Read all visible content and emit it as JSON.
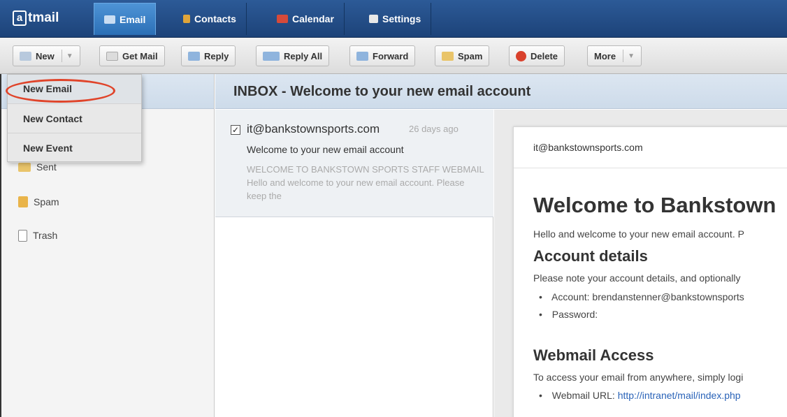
{
  "app": {
    "logo_text": "tmail",
    "logo_prefix": "a"
  },
  "nav": {
    "tabs": [
      {
        "label": "Email",
        "active": true
      },
      {
        "label": "Contacts",
        "active": false
      },
      {
        "label": "Calendar",
        "active": false
      },
      {
        "label": "Settings",
        "active": false
      }
    ]
  },
  "toolbar": {
    "new_label": "New",
    "get_mail_label": "Get Mail",
    "reply_label": "Reply",
    "reply_all_label": "Reply All",
    "forward_label": "Forward",
    "spam_label": "Spam",
    "delete_label": "Delete",
    "more_label": "More"
  },
  "new_menu": {
    "items": [
      "New Email",
      "New Contact",
      "New Event"
    ],
    "highlighted": "New Email",
    "highlight_color": "#e0442a"
  },
  "folders": [
    {
      "label": "Sent",
      "icon": "sent-icon"
    },
    {
      "label": "Spam",
      "icon": "spam-folder-icon"
    },
    {
      "label": "Trash",
      "icon": "trash-icon"
    }
  ],
  "inbox": {
    "title": "INBOX - Welcome to your new email account"
  },
  "message": {
    "from": "it@bankstownsports.com",
    "age": "26 days ago",
    "subject": "Welcome to your new email account",
    "preview": "WELCOME TO BANKSTOWN SPORTS STAFF WEBMAIL Hello and welcome to your new email account. Please keep the",
    "checked": true
  },
  "reading": {
    "from": "it@bankstownsports.com",
    "heading": "Welcome to Bankstown",
    "intro": "Hello and welcome to your new email account. P",
    "account_heading": "Account details",
    "account_note": "Please note your account details, and optionally",
    "account_label": "Account:",
    "account_value": "brendanstenner@bankstownsports",
    "password_label": "Password:",
    "webmail_heading": "Webmail Access",
    "webmail_note": "To access your email from anywhere, simply logi",
    "webmail_url_label": "Webmail URL:",
    "webmail_url": "http://intranet/mail/index.php"
  },
  "colors": {
    "nav_bg": "#1d4379",
    "active_tab": "#2b6fb6",
    "link": "#2a63b8"
  }
}
